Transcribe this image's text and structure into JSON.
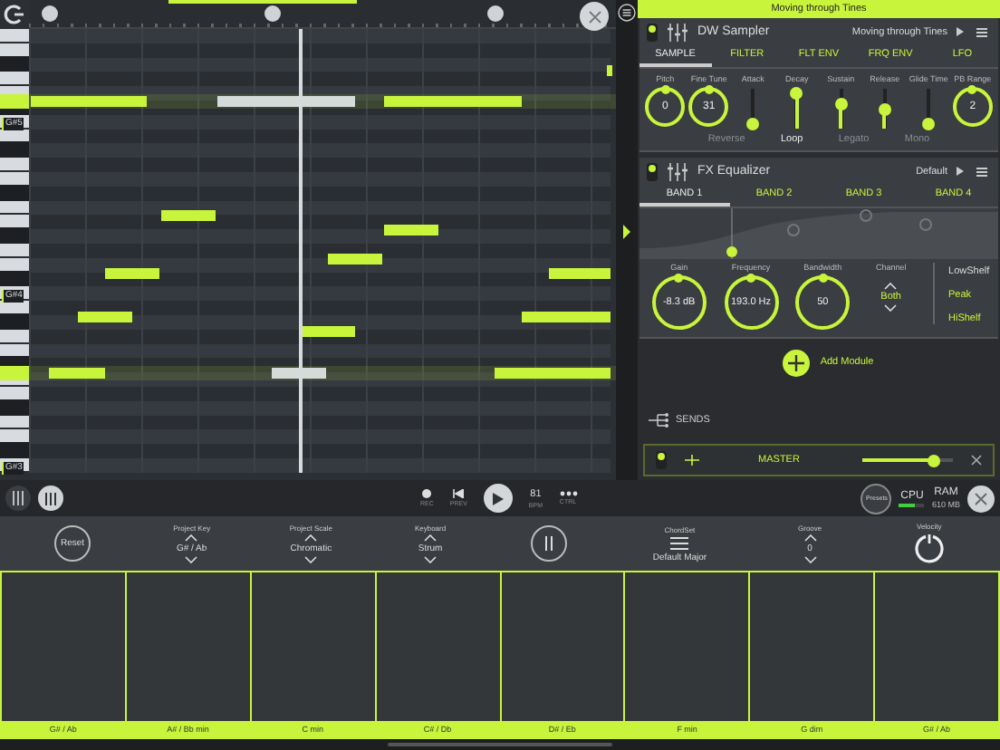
{
  "piano_roll": {
    "key_labels": [
      "G#5",
      "G#4",
      "G#3"
    ]
  },
  "now_playing": "Moving through Tines",
  "sampler": {
    "on": true,
    "title": "DW Sampler",
    "preset": "Moving through Tines",
    "tabs": [
      {
        "label": "SAMPLE",
        "selected": true
      },
      {
        "label": "FILTER",
        "selected": false
      },
      {
        "label": "FLT ENV",
        "selected": false
      },
      {
        "label": "FRQ ENV",
        "selected": false
      },
      {
        "label": "LFO",
        "selected": false
      }
    ],
    "params": [
      {
        "kind": "knob",
        "label": "Pitch",
        "value": "0"
      },
      {
        "kind": "knob",
        "label": "Fine Tune",
        "value": "31"
      },
      {
        "kind": "slider",
        "label": "Attack",
        "level": 0.1
      },
      {
        "kind": "slider",
        "label": "Decay",
        "level": 0.9
      },
      {
        "kind": "slider",
        "label": "Sustain",
        "level": 0.6
      },
      {
        "kind": "slider",
        "label": "Release",
        "level": 0.5
      },
      {
        "kind": "slider",
        "label": "Glide Time",
        "level": 0.1
      },
      {
        "kind": "knob",
        "label": "PB Range",
        "value": "2"
      }
    ],
    "toggles": [
      {
        "label": "Reverse",
        "on": false
      },
      {
        "label": "Loop",
        "on": true
      },
      {
        "label": "Legato",
        "on": false
      },
      {
        "label": "Mono",
        "on": false
      }
    ]
  },
  "equalizer": {
    "on": true,
    "title": "FX Equalizer",
    "preset": "Default",
    "bands": [
      {
        "label": "BAND 1",
        "selected": true
      },
      {
        "label": "BAND 2",
        "selected": false
      },
      {
        "label": "BAND 3",
        "selected": false
      },
      {
        "label": "BAND 4",
        "selected": false
      }
    ],
    "params": [
      {
        "kind": "knob",
        "label": "Gain",
        "value": "-8.3 dB"
      },
      {
        "kind": "knob",
        "label": "Frequency",
        "value": "193.0 Hz"
      },
      {
        "kind": "knob",
        "label": "Bandwidth",
        "value": "50"
      },
      {
        "kind": "stepper",
        "label": "Channel",
        "value": "Both"
      }
    ],
    "filter_types": [
      {
        "label": "LowShelf",
        "selected": true
      },
      {
        "label": "Peak",
        "selected": false
      },
      {
        "label": "HiShelf",
        "selected": false
      }
    ]
  },
  "add_module": "Add Module",
  "sends": {
    "title": "SENDS",
    "channels": [
      {
        "name": "MASTER",
        "on": true,
        "level": 0.78
      }
    ]
  },
  "transport": [
    {
      "kind": "rec",
      "label": "REC"
    },
    {
      "kind": "prev",
      "label": "PREV"
    },
    {
      "kind": "play"
    },
    {
      "kind": "bpm",
      "value": "81",
      "label": "BPM"
    },
    {
      "kind": "more",
      "label": "CTRL"
    }
  ],
  "presets": "Presets",
  "cpu": {
    "label": "CPU",
    "level": 0.6
  },
  "ram": {
    "label": "RAM",
    "value": "610 MB"
  },
  "controls": [
    {
      "kind": "button",
      "label": "Reset"
    },
    {
      "kind": "stepper",
      "title": "Project Key",
      "value": "G# / Ab"
    },
    {
      "kind": "stepper",
      "title": "Project Scale",
      "value": "Chromatic"
    },
    {
      "kind": "stepper",
      "title": "Keyboard",
      "value": "Strum"
    },
    {
      "kind": "hold"
    },
    {
      "kind": "menu",
      "title": "ChordSet",
      "value": "Default Major"
    },
    {
      "kind": "stepper",
      "title": "Groove",
      "value": "0"
    },
    {
      "kind": "knob",
      "title": "Velocity"
    }
  ],
  "pads": [
    "G# / Ab",
    "A# / Bb min",
    "C min",
    "C# / Db",
    "D# / Eb",
    "F min",
    "G dim",
    "G# / Ab"
  ]
}
